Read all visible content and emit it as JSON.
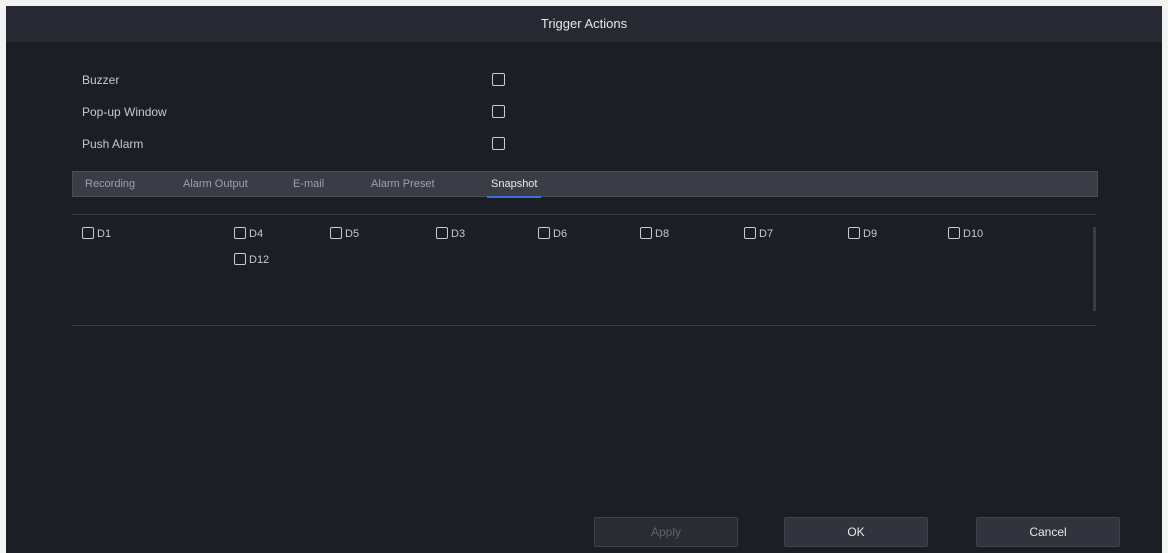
{
  "dialog": {
    "title": "Trigger Actions"
  },
  "options": [
    {
      "label": "Buzzer"
    },
    {
      "label": "Pop-up Window"
    },
    {
      "label": "Push Alarm"
    }
  ],
  "tabs": [
    {
      "label": "Recording"
    },
    {
      "label": "Alarm Output"
    },
    {
      "label": "E-mail"
    },
    {
      "label": "Alarm Preset"
    },
    {
      "label": "Snapshot"
    }
  ],
  "active_tab": "Snapshot",
  "channels": [
    "D1",
    "D4",
    "D5",
    "D3",
    "D6",
    "D8",
    "D7",
    "D9",
    "D10",
    "D12"
  ],
  "buttons": {
    "apply": "Apply",
    "ok": "OK",
    "cancel": "Cancel"
  },
  "colors": {
    "dialog_bg": "#1c1e25",
    "accent": "#3c6fd8"
  }
}
